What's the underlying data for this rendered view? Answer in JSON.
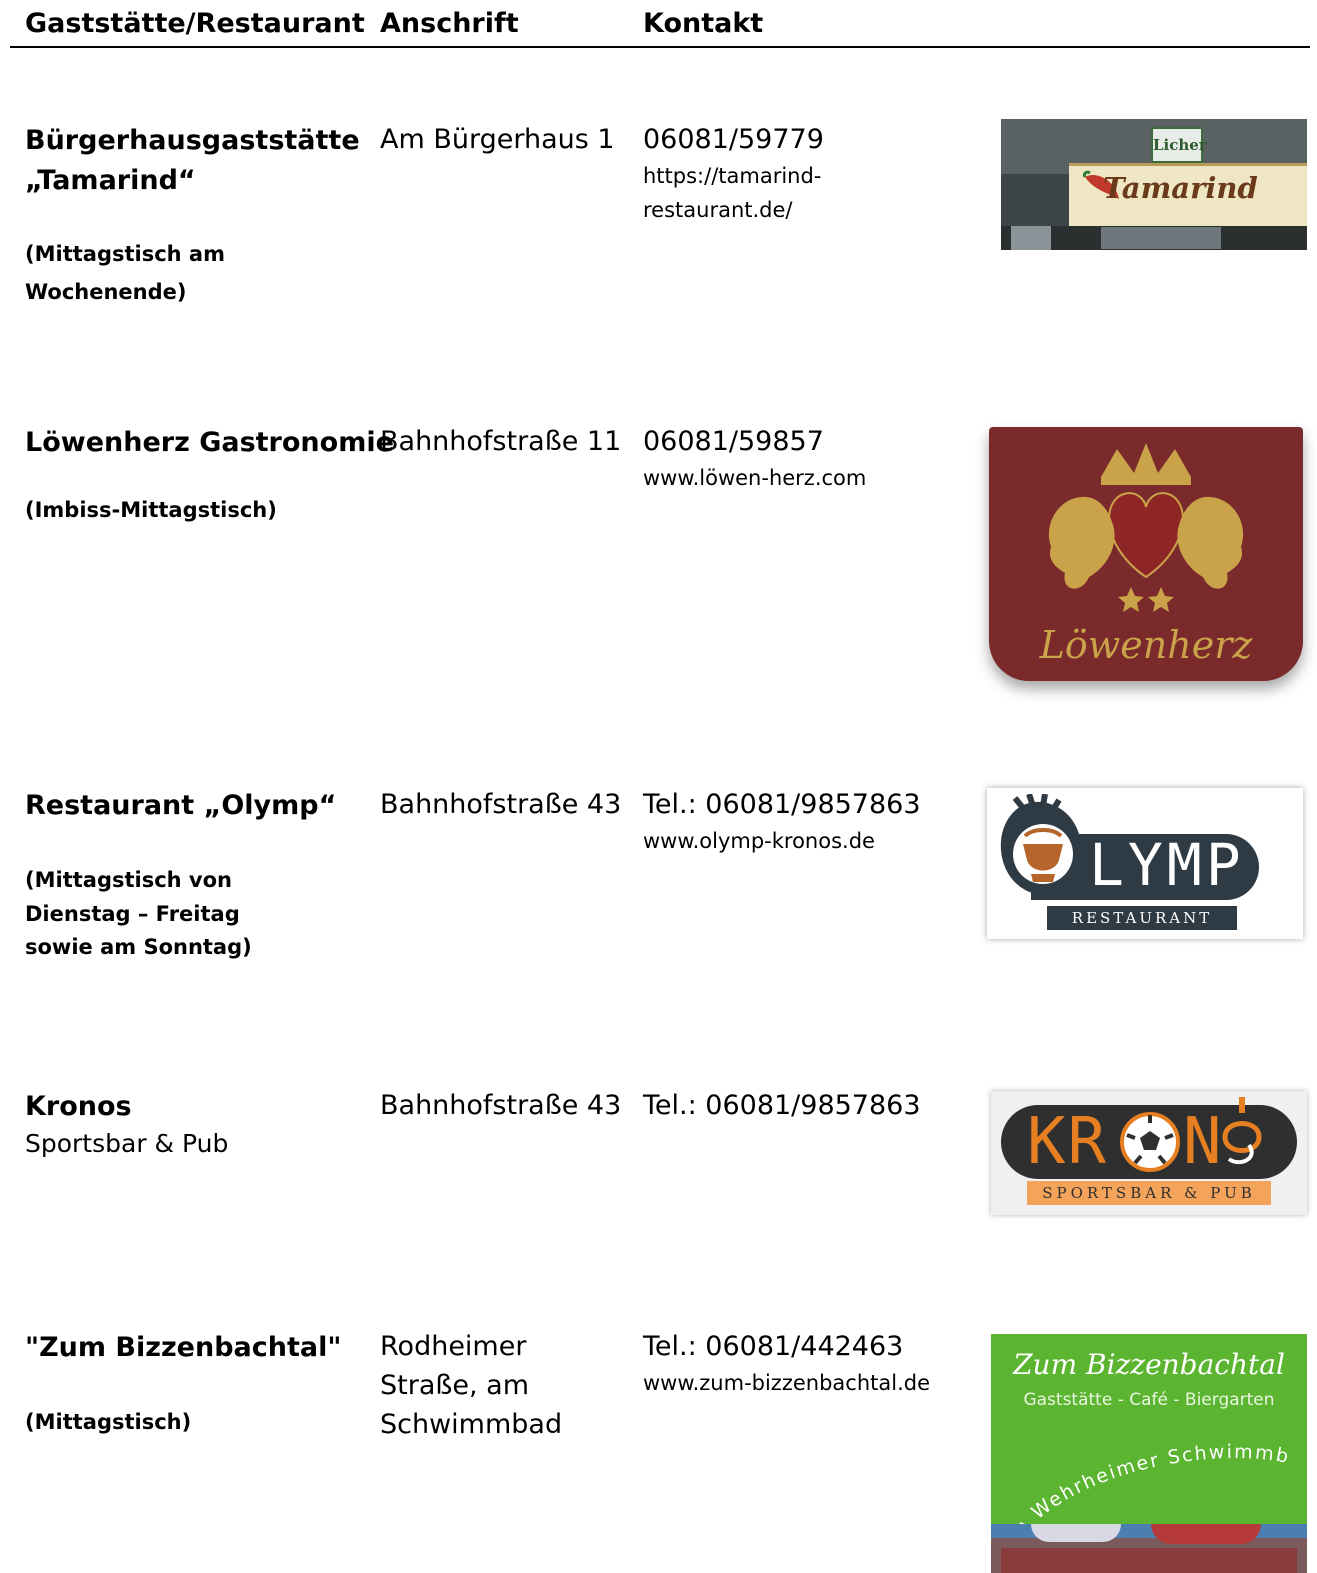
{
  "header": {
    "col1": "Gaststätte/Restaurant",
    "col2": "Anschrift",
    "col3": "Kontakt"
  },
  "entries": [
    {
      "name_line1": "Bürgerhausgaststätte",
      "name_line2": "„Tamarind“",
      "note_line1": "(Mittagstisch am",
      "note_line2": "Wochenende)",
      "address": "Am Bürgerhaus 1",
      "phone": "06081/59779",
      "web_line1": "https://tamarind-",
      "web_line2": "restaurant.de/",
      "logo": {
        "sign_small": "Licher",
        "sign_main": "Tamarind",
        "icon": "storefront-sign-photo"
      }
    },
    {
      "name": "Löwenherz Gastronomie",
      "note": "(Imbiss-Mittagstisch)",
      "address": "Bahnhofstraße 11",
      "phone": "06081/59857",
      "web": "www.löwen-herz.com",
      "logo": {
        "text": "Löwenherz",
        "icon": "lion-crest-icon",
        "bg": "#7a2a2a",
        "fg": "#c9a24a"
      }
    },
    {
      "name": "Restaurant „Olymp“",
      "note_line1": "(Mittagstisch von",
      "note_line2": "Dienstag – Freitag",
      "note_line3": "sowie am Sonntag)",
      "address": "Bahnhofstraße 43",
      "phone": "Tel.: 06081/9857863",
      "web": "www.olymp-kronos.de",
      "logo": {
        "text": "LYMP",
        "sub": "RESTAURANT",
        "icon": "urn-icon",
        "bg": "#2e3a44"
      }
    },
    {
      "name": "Kronos",
      "sub": "Sportsbar & Pub",
      "address": "Bahnhofstraße 43",
      "phone": "Tel.: 06081/9857863",
      "logo": {
        "text_left": "KR",
        "text_right": "N",
        "sub": "SPORTSBAR & PUB",
        "icon": "football-icon",
        "accent": "#e67e22"
      }
    },
    {
      "name": "\"Zum Bizzenbachtal\"",
      "note": "(Mittagstisch)",
      "address_line1": "Rodheimer",
      "address_line2": "Straße, am",
      "address_line3": "Schwimmbad",
      "phone": "Tel.: 06081/442463",
      "web": "www.zum-bizzenbachtal.de",
      "logo": {
        "title": "Zum Bizzenbachtal",
        "tagline": "Gaststätte - Café - Biergarten",
        "arc": "Am Wehrheimer Schwimmbad",
        "bg": "#5cb531"
      }
    }
  ]
}
